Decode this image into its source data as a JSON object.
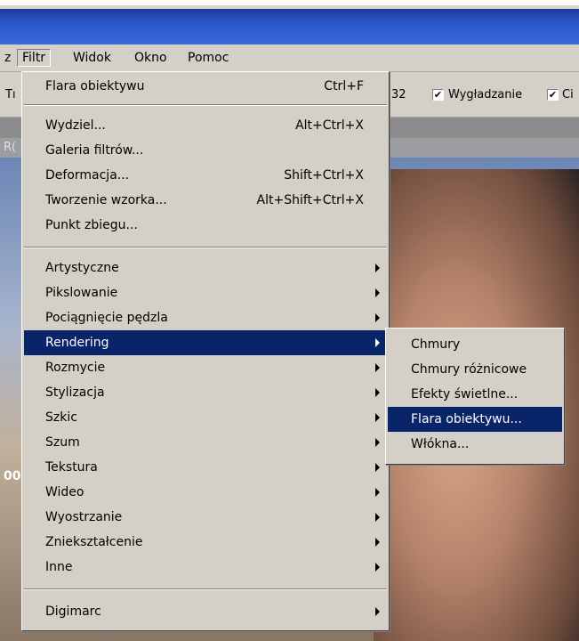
{
  "menubar": {
    "items": [
      {
        "label": "z"
      },
      {
        "label": "Filtr"
      },
      {
        "label": "Widok"
      },
      {
        "label": "Okno"
      },
      {
        "label": "Pomoc"
      }
    ]
  },
  "options": {
    "left_text": "Tı",
    "number_fragment": "32",
    "wygladzanie_label": "Wygładzanie",
    "wygladzanie_checked": true,
    "ci_label": "Ci",
    "ci_checked": true
  },
  "docbar": {
    "left_text": "R("
  },
  "photo": {
    "side_text": "00"
  },
  "filter_menu": {
    "items": [
      {
        "label": "Flara obiektywu",
        "shortcut": "Ctrl+F"
      },
      {
        "label": "Wydziel...",
        "shortcut": "Alt+Ctrl+X"
      },
      {
        "label": "Galeria filtrów...",
        "shortcut": ""
      },
      {
        "label": "Deformacja...",
        "shortcut": "Shift+Ctrl+X"
      },
      {
        "label": "Tworzenie wzorka...",
        "shortcut": "Alt+Shift+Ctrl+X"
      },
      {
        "label": "Punkt zbiegu...",
        "shortcut": ""
      },
      {
        "label": "Artystyczne",
        "submenu": true
      },
      {
        "label": "Pikslowanie",
        "submenu": true
      },
      {
        "label": "Pociągnięcie pędzla",
        "submenu": true
      },
      {
        "label": "Rendering",
        "submenu": true,
        "highlighted": true
      },
      {
        "label": "Rozmycie",
        "submenu": true
      },
      {
        "label": "Stylizacja",
        "submenu": true
      },
      {
        "label": "Szkic",
        "submenu": true
      },
      {
        "label": "Szum",
        "submenu": true
      },
      {
        "label": "Tekstura",
        "submenu": true
      },
      {
        "label": "Wideo",
        "submenu": true
      },
      {
        "label": "Wyostrzanie",
        "submenu": true
      },
      {
        "label": "Zniekształcenie",
        "submenu": true
      },
      {
        "label": "Inne",
        "submenu": true
      },
      {
        "label": "Digimarc",
        "submenu": true
      }
    ]
  },
  "rendering_submenu": {
    "items": [
      {
        "label": "Chmury"
      },
      {
        "label": "Chmury różnicowe"
      },
      {
        "label": "Efekty świetlne..."
      },
      {
        "label": "Flara obiektywu...",
        "highlighted": true
      },
      {
        "label": "Włókna..."
      }
    ]
  },
  "colors": {
    "menu_bg": "#d4d0c8",
    "highlight": "#0a246a",
    "title_blue": "#2a55c9"
  }
}
